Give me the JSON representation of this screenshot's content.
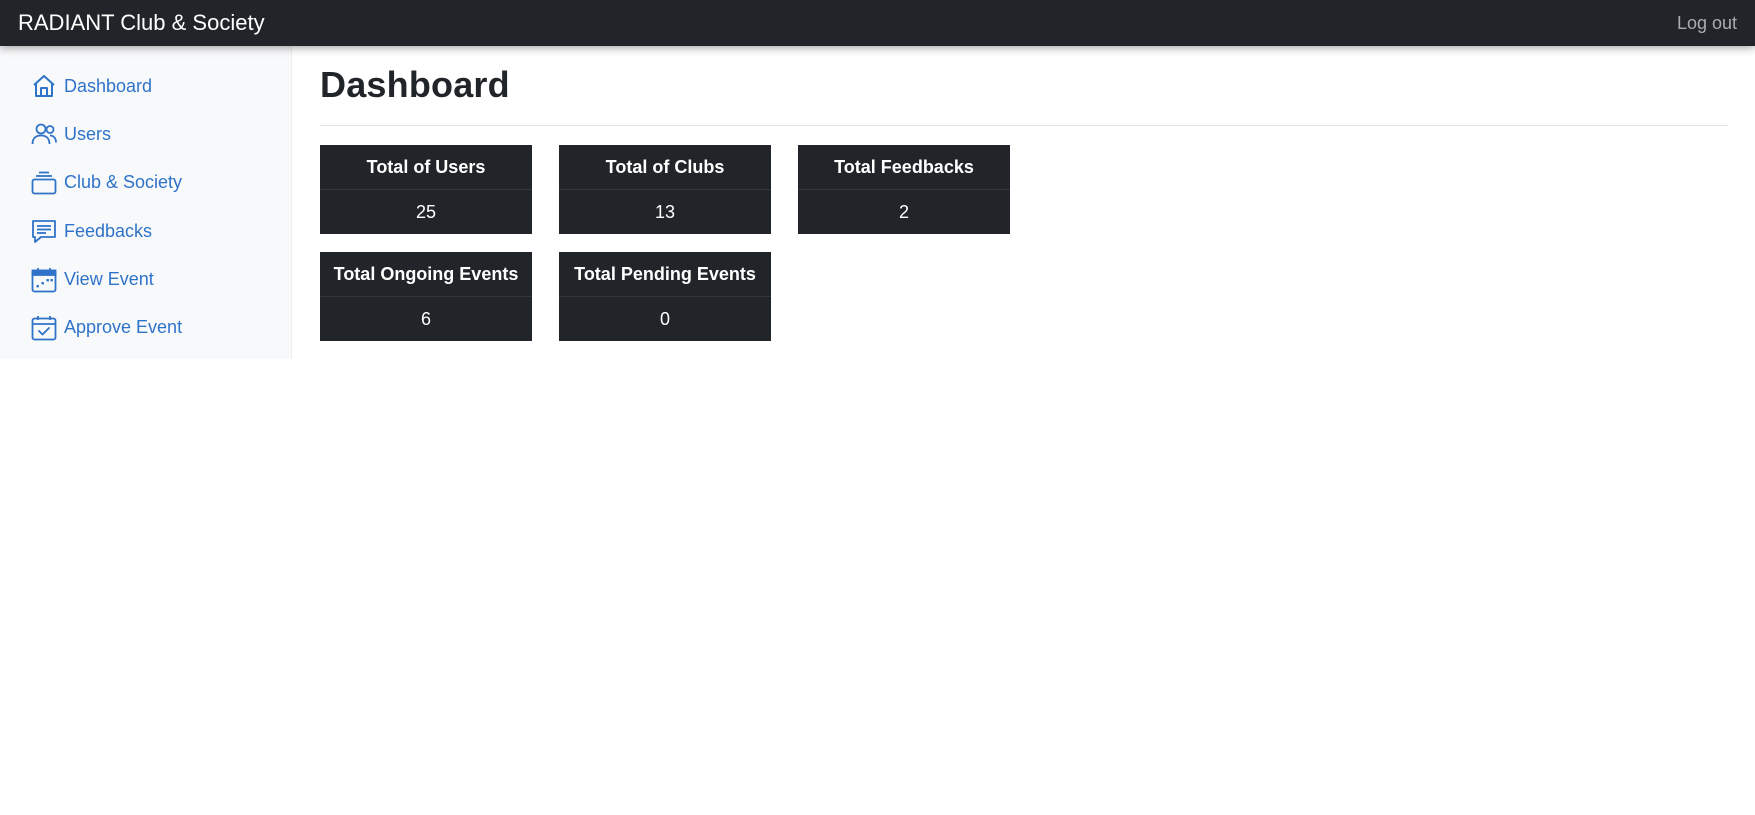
{
  "app": {
    "brand": "RADIANT Club & Society",
    "logout_label": "Log out"
  },
  "sidebar": {
    "items": [
      {
        "label": "Dashboard",
        "icon": "house-icon"
      },
      {
        "label": "Users",
        "icon": "people-icon"
      },
      {
        "label": "Club & Society",
        "icon": "collection-icon"
      },
      {
        "label": "Feedbacks",
        "icon": "chat-text-icon"
      },
      {
        "label": "View Event",
        "icon": "calendar-event-icon"
      },
      {
        "label": "Approve Event",
        "icon": "calendar-check-icon"
      }
    ],
    "link_color": "#2f73c9"
  },
  "main": {
    "title": "Dashboard",
    "stats": [
      {
        "label": "Total of Users",
        "value": "25"
      },
      {
        "label": "Total of Clubs",
        "value": "13"
      },
      {
        "label": "Total Feedbacks",
        "value": "2"
      },
      {
        "label": "Total Ongoing Events",
        "value": "6"
      },
      {
        "label": "Total Pending Events",
        "value": "0"
      }
    ]
  },
  "colors": {
    "navbar": "#212529",
    "card": "#212529",
    "sidebar": "#f8f9fa"
  }
}
